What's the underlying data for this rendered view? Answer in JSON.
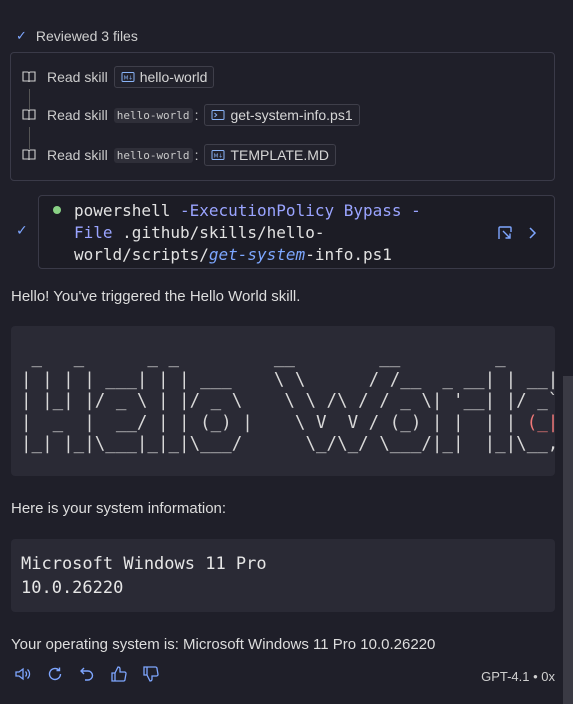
{
  "header": {
    "reviewed_label": "Reviewed 3 files"
  },
  "files": [
    {
      "action": "Read skill",
      "scope": "",
      "name": "hello-world",
      "icon": "markdown-file-icon"
    },
    {
      "action": "Read skill",
      "scope": "hello-world",
      "name": "get-system-info.ps1",
      "icon": "powershell-file-icon"
    },
    {
      "action": "Read skill",
      "scope": "hello-world",
      "name": "TEMPLATE.MD",
      "icon": "markdown-file-icon"
    }
  ],
  "command": {
    "line1a": "powershell ",
    "line1b": "-ExecutionPolicy Bypass -",
    "line2a": "File ",
    "line2b": ".github/skills/hello-",
    "line3a": "world/scripts/",
    "line3b": "get-system",
    "line3c": "-info.ps1"
  },
  "messages": {
    "greeting": "Hello! You've triggered the Hello World skill.",
    "sysinfo_intro": "Here is your system information:",
    "os_result": "Your operating system is: Microsoft Windows 11 Pro 10.0.26220"
  },
  "ascii_art": {
    "l1": " _   _      _ _         __        __         _      _",
    "l2": "| | | | ___| | | ___    \\ \\      / /__  _ __| | __| |",
    "l3": "| |_| |/ _ \\ | |/ _ \\    \\ \\ /\\ / / _ \\| '__| |/ _`",
    "l4a": "|  _  |  __/ | | (_) |    \\ V  V / (_) | |  | | ",
    "l4b": "(_|",
    "l5": "|_| |_|\\___|_|_|\\___/      \\_/\\_/ \\___/|_|  |_|\\__,_"
  },
  "system_info": {
    "os_name": "Microsoft Windows 11 Pro",
    "os_version": "10.0.26220"
  },
  "footer": {
    "model_label": "GPT-4.1 • 0x"
  },
  "colors": {
    "accent": "#7ea6ff",
    "running_dot": "#89d185",
    "background": "#1f1f29",
    "code_bg": "#2a2a35"
  }
}
